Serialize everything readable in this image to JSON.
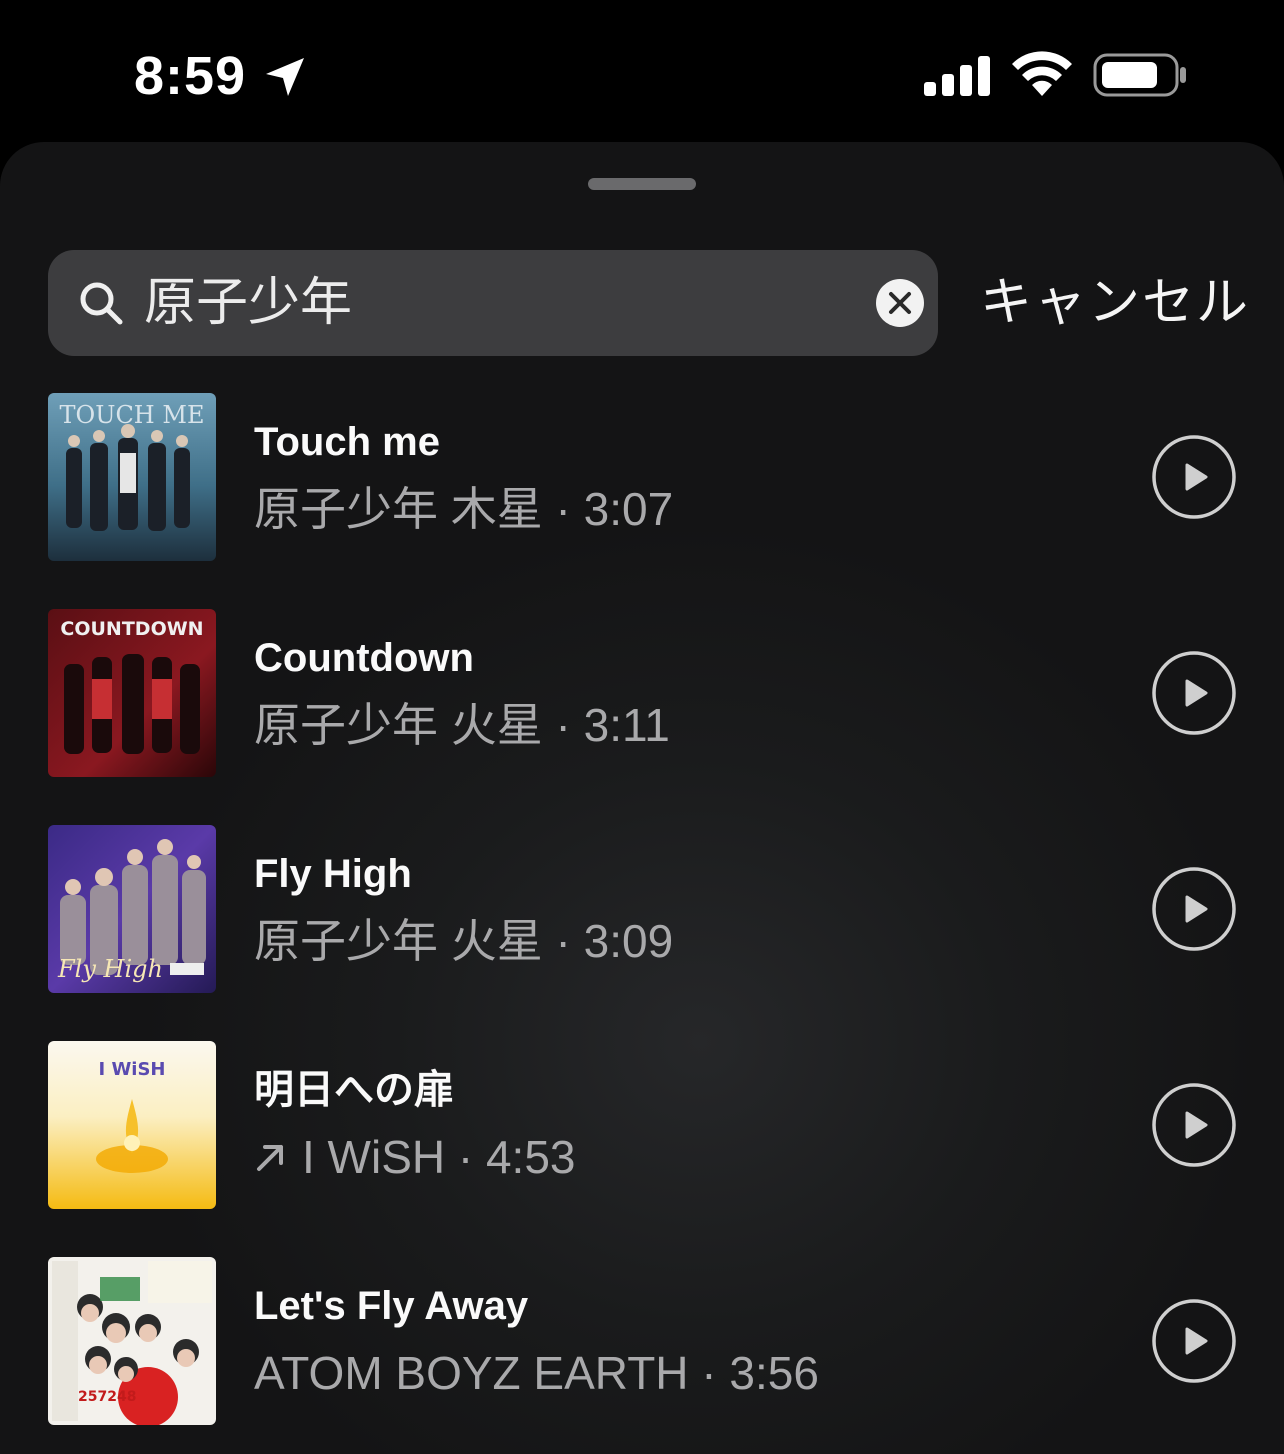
{
  "status_bar": {
    "time": "8:59",
    "icons": [
      "location-arrow-icon",
      "cellular-signal-icon",
      "wifi-icon",
      "battery-icon"
    ]
  },
  "search": {
    "query": "原子少年",
    "cancel_label": "キャンセル"
  },
  "results": [
    {
      "title": "Touch me",
      "subtitle": "原子少年 木星 · 3:07",
      "art_text": "TOUCH ME",
      "art_theme": "teal"
    },
    {
      "title": "Countdown",
      "subtitle": "原子少年 火星 · 3:11",
      "art_text": "COUNTDOWN",
      "art_theme": "red"
    },
    {
      "title": "Fly High",
      "subtitle": "原子少年 火星 · 3:09",
      "art_text": "Fly High",
      "art_theme": "purple"
    },
    {
      "title": "明日への扉",
      "subtitle": "I WiSH · 4:53",
      "trending": true,
      "art_text": "I WiSH",
      "art_theme": "yellow"
    },
    {
      "title": "Let's Fly Away",
      "subtitle": "ATOM BOYZ EARTH · 3:56",
      "art_text": "257248",
      "art_theme": "white"
    }
  ]
}
